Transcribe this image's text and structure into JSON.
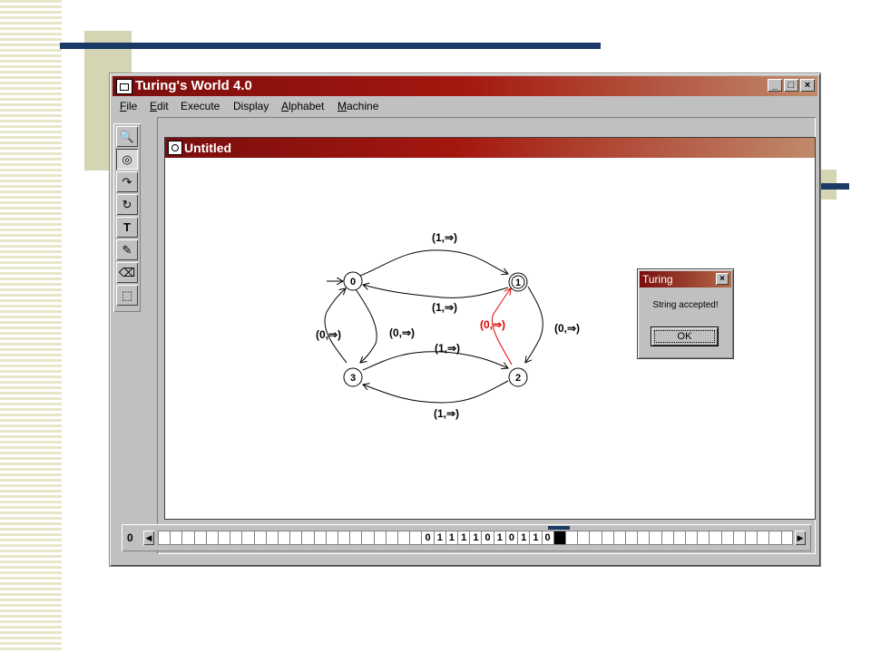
{
  "app": {
    "title": "Turing's World 4.0",
    "window_buttons": [
      "_",
      "□",
      "×"
    ]
  },
  "menu": [
    {
      "label": "File",
      "mnemonic": "F",
      "rest": "ile"
    },
    {
      "label": "Edit",
      "mnemonic": "E",
      "rest": "dit"
    },
    {
      "label": "Execute",
      "mnemonic": "",
      "rest": "Execute"
    },
    {
      "label": "Display",
      "mnemonic": "",
      "rest": "Display"
    },
    {
      "label": "Alphabet",
      "mnemonic": "A",
      "rest": "lphabet"
    },
    {
      "label": "Machine",
      "mnemonic": "M",
      "rest": "achine"
    }
  ],
  "tools": [
    {
      "name": "zoom-tool-icon",
      "glyph": "🔍"
    },
    {
      "name": "state-tool-icon",
      "glyph": "◎",
      "selected": true
    },
    {
      "name": "arrow-tool-icon",
      "glyph": "↷"
    },
    {
      "name": "loop-tool-icon",
      "glyph": "↻"
    },
    {
      "name": "text-tool-icon",
      "glyph": "T"
    },
    {
      "name": "pen-tool-icon",
      "glyph": "✎"
    },
    {
      "name": "eraser-tool-icon",
      "glyph": "⌫"
    },
    {
      "name": "select-tool-icon",
      "glyph": "⬚"
    }
  ],
  "document": {
    "title": "Untitled"
  },
  "machine": {
    "start_state": "0",
    "accepting_state": "1",
    "states": [
      "0",
      "1",
      "2",
      "3"
    ],
    "transitions": [
      {
        "from": "0",
        "to": "1",
        "label": "(1,⇒)",
        "highlight": false
      },
      {
        "from": "1",
        "to": "0",
        "label": "(1,⇒)",
        "highlight": false
      },
      {
        "from": "1",
        "to": "2",
        "label": "(0,⇒)",
        "highlight": false
      },
      {
        "from": "2",
        "to": "1",
        "label": "(0,⇒)",
        "highlight": true
      },
      {
        "from": "0",
        "to": "2",
        "label": "(0,⇒)",
        "highlight": false
      },
      {
        "from": "3",
        "to": "0",
        "label": "(0,⇒)",
        "highlight": false
      },
      {
        "from": "3",
        "to": "2",
        "label": "(1,⇒)",
        "highlight": false
      },
      {
        "from": "2",
        "to": "3",
        "label": "(1,⇒)",
        "highlight": false
      }
    ],
    "colors": {
      "normal": "#000000",
      "highlight": "#e00000"
    }
  },
  "dialog": {
    "title": "Turing",
    "message": "String accepted!",
    "ok_label": "OK",
    "close_glyph": "×"
  },
  "tape": {
    "position": "0",
    "left_arrow": "◀",
    "right_arrow": "▶",
    "cells": [
      "",
      "",
      "",
      "",
      "",
      "",
      "",
      "",
      "",
      "",
      "",
      "",
      "",
      "",
      "",
      "",
      "",
      "",
      "",
      "",
      "",
      "",
      "0",
      "1",
      "1",
      "1",
      "1",
      "0",
      "1",
      "0",
      "1",
      "1",
      "0",
      "",
      "",
      "",
      "",
      "",
      "",
      "",
      "",
      "",
      "",
      "",
      "",
      "",
      "",
      "",
      "",
      "",
      "",
      "",
      ""
    ],
    "head_index": 33
  }
}
